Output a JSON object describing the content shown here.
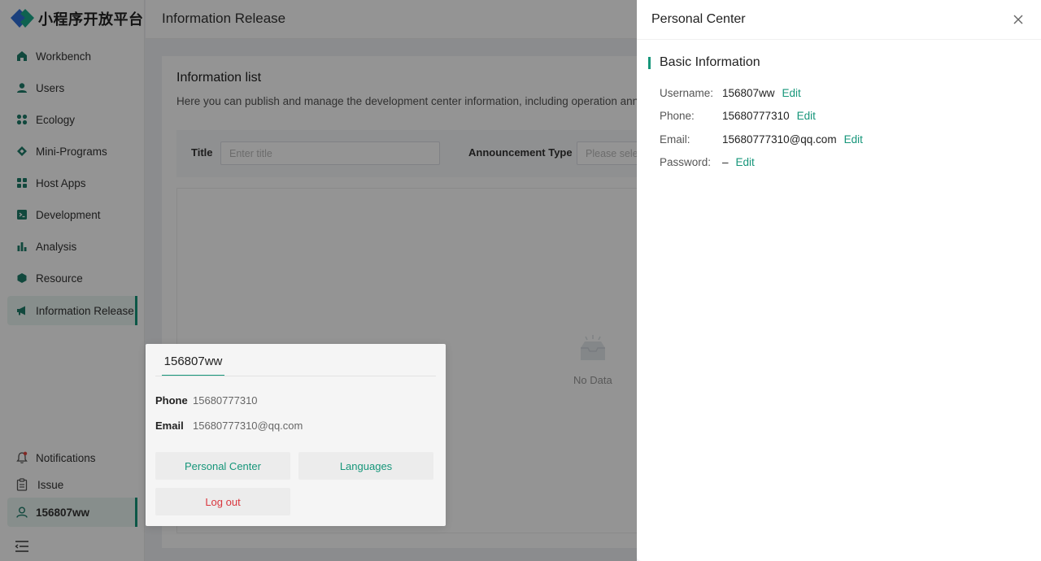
{
  "app": {
    "logo_text": "小程序开放平台",
    "page_title": "Information Release"
  },
  "sidebar": {
    "items": [
      {
        "label": "Workbench",
        "icon": "home-icon"
      },
      {
        "label": "Users",
        "icon": "user-icon"
      },
      {
        "label": "Ecology",
        "icon": "ecology-icon"
      },
      {
        "label": "Mini-Programs",
        "icon": "mini-program-icon"
      },
      {
        "label": "Host Apps",
        "icon": "host-apps-icon"
      },
      {
        "label": "Development",
        "icon": "terminal-icon"
      },
      {
        "label": "Analysis",
        "icon": "bar-chart-icon"
      },
      {
        "label": "Resource",
        "icon": "resource-icon"
      },
      {
        "label": "Information Release",
        "icon": "megaphone-icon",
        "active": true
      }
    ],
    "bottom": {
      "notifications": "Notifications",
      "issue": "Issue",
      "user": "156807ww"
    }
  },
  "main": {
    "card_title": "Information list",
    "description": "Here you can publish and manage the development center information, including operation annou",
    "filters": {
      "title_label": "Title",
      "title_placeholder": "Enter title",
      "type_label": "Announcement Type",
      "type_placeholder": "Please sele"
    },
    "empty_text": "No Data"
  },
  "popover": {
    "username": "156807ww",
    "phone_label": "Phone",
    "phone": "15680777310",
    "email_label": "Email",
    "email": "15680777310@qq.com",
    "personal_center": "Personal Center",
    "languages": "Languages",
    "logout": "Log out"
  },
  "drawer": {
    "title": "Personal Center",
    "section": "Basic Information",
    "edit_label": "Edit",
    "rows": [
      {
        "label": "Username:",
        "value": "156807ww"
      },
      {
        "label": "Phone:",
        "value": "15680777310"
      },
      {
        "label": "Email:",
        "value": "15680777310@qq.com"
      },
      {
        "label": "Password:",
        "value": "–"
      }
    ]
  },
  "colors": {
    "accent": "#16967a",
    "logout": "#d9363e"
  }
}
